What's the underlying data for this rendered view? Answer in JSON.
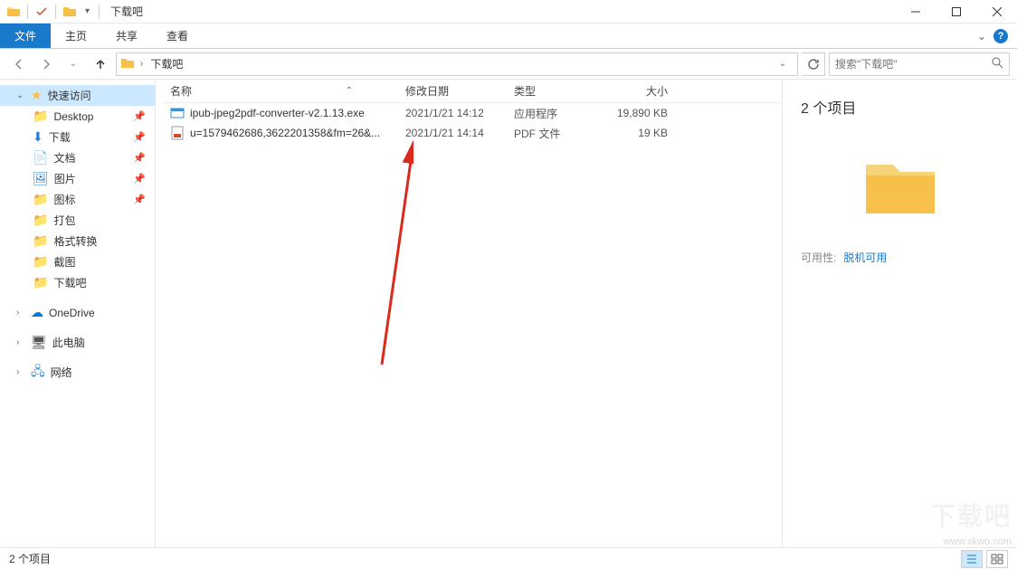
{
  "titlebar": {
    "title": "下载吧"
  },
  "ribbon": {
    "file": "文件",
    "tabs": [
      "主页",
      "共享",
      "查看"
    ]
  },
  "nav": {
    "back_enabled": false,
    "forward_enabled": false
  },
  "address": {
    "crumb": "下载吧"
  },
  "search": {
    "placeholder": "搜索\"下载吧\""
  },
  "navpane": {
    "quick_access": "快速访问",
    "items": [
      {
        "label": "Desktop",
        "icon": "folder",
        "pinned": true
      },
      {
        "label": "下载",
        "icon": "download",
        "pinned": true
      },
      {
        "label": "文档",
        "icon": "document",
        "pinned": true
      },
      {
        "label": "图片",
        "icon": "picture",
        "pinned": true
      },
      {
        "label": "图标",
        "icon": "folder",
        "pinned": true
      },
      {
        "label": "打包",
        "icon": "folder",
        "pinned": false
      },
      {
        "label": "格式转换",
        "icon": "folder",
        "pinned": false
      },
      {
        "label": "截图",
        "icon": "folder",
        "pinned": false
      },
      {
        "label": "下载吧",
        "icon": "folder",
        "pinned": false
      }
    ],
    "onedrive": "OneDrive",
    "thispc": "此电脑",
    "network": "网络"
  },
  "columns": {
    "name": "名称",
    "date": "修改日期",
    "type": "类型",
    "size": "大小"
  },
  "files": [
    {
      "name": "ipub-jpeg2pdf-converter-v2.1.13.exe",
      "date": "2021/1/21 14:12",
      "type": "应用程序",
      "size": "19,890 KB",
      "icon": "exe"
    },
    {
      "name": "u=1579462686,3622201358&fm=26&...",
      "date": "2021/1/21 14:14",
      "type": "PDF 文件",
      "size": "19 KB",
      "icon": "pdf"
    }
  ],
  "details": {
    "count_label": "2 个项目",
    "avail_label": "可用性:",
    "avail_value": "脱机可用"
  },
  "status": {
    "text": "2 个项目"
  },
  "watermark": "www.xkwo.com"
}
